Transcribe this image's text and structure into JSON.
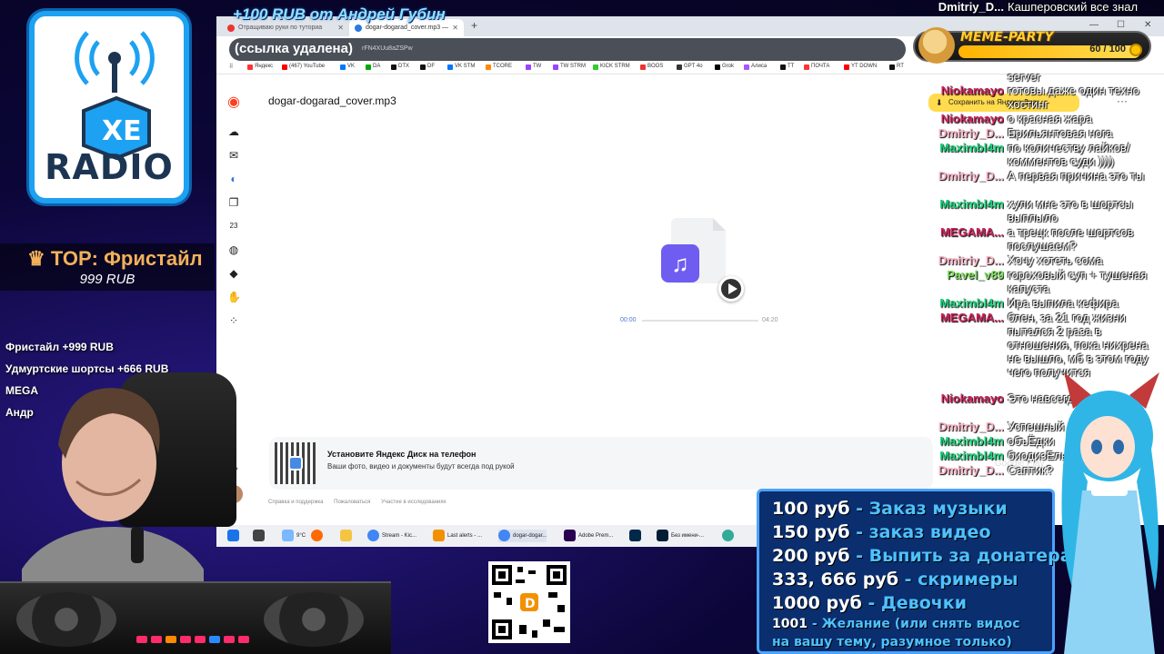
{
  "logo": {
    "text": "RADIO"
  },
  "top_donor": {
    "label": "TOP: Фристайл",
    "amount": "999 RUB"
  },
  "donors": [
    "Фристайл +999 RUB",
    "Удмуртские шортсы +666 RUB",
    "MEGA",
    "Андр"
  ],
  "banner": {
    "text": "+100 RUB  от Андрей Губин"
  },
  "browser": {
    "tabs": [
      {
        "label": "Отращиваю руки по туториа",
        "active": false
      },
      {
        "label": "dogar-dogarad_cover.mp3 —",
        "active": true
      }
    ],
    "new_tab": "+",
    "url_removed": "(ссылка удалена)",
    "url_tail": "rFN4XUu8aZSPw",
    "bookmarks": [
      "Яндекс",
      "(467) YouTube",
      "VK",
      "DA",
      "DTX",
      "DF",
      "VK STM",
      "TCORE",
      "TW",
      "TW STRM",
      "KICK STRM",
      "BOOS",
      "GPT 4o",
      "Grok",
      "Алиса",
      "TT",
      "ПОЧТА",
      "YT DOWN",
      "RT"
    ],
    "file_title": "dogar-dogarad_cover.mp3",
    "save_button": "Сохранить на Яндекс Диск",
    "more": "···",
    "player": {
      "current": "00:00",
      "total": "04:20",
      "progress": 0
    },
    "promo": {
      "title": "Установите Яндекс Диск на телефон",
      "subtitle": "Ваши фото, видео и документы будут всегда под рукой"
    },
    "footer_links": [
      "Справка и поддержка",
      "Пожаловаться",
      "Участие в исследованиях"
    ],
    "google_play": "Google Play"
  },
  "taskbar": {
    "weather": "9°C",
    "items": [
      "Stream - Kic...",
      "Last alerts - ...",
      "dogar-dogar...",
      "Adobe Prem...",
      "",
      "Без имени-..."
    ]
  },
  "meme_party": {
    "title": "MEME-PARTY",
    "count": "60 / 100"
  },
  "chat": [
    {
      "nick": "Dmitriy_D...",
      "color": "#ffffff",
      "text": "Кашперовский все знал"
    },
    {
      "nick": "",
      "color": "#ffffff",
      "text": "server"
    },
    {
      "nick": "Niokamayo",
      "color": "#d0215a",
      "text": "готовы даже один техно хостинг"
    },
    {
      "nick": "Niokamayo",
      "color": "#d0215a",
      "text": "о красная жара"
    },
    {
      "nick": "Dmitriy_D...",
      "color": "#ffb3c7",
      "text": "Брильянтовая нога"
    },
    {
      "nick": "Maximbl4m",
      "color": "#19d37a",
      "text": "по количеству лайков/комментов суди ))))"
    },
    {
      "nick": "Dmitriy_D...",
      "color": "#ffb3c7",
      "text": "А первая причина это ты"
    },
    {
      "nick": "Maximbl4m",
      "color": "#19d37a",
      "text": "хули мне это в шортсы выплыло"
    },
    {
      "nick": "MEGAMA...",
      "color": "#d0215a",
      "text": "а трецк после шортсов послушаем?"
    },
    {
      "nick": "Dmitriy_D...",
      "color": "#ffb3c7",
      "text": "Хочу хотеть сома"
    },
    {
      "nick": "Pavel_v89",
      "color": "#7be05a",
      "text": "гороховый суп + тушеная капуста"
    },
    {
      "nick": "Maximbl4m",
      "color": "#19d37a",
      "text": "Ира выпила кефира"
    },
    {
      "nick": "MEGAMA...",
      "color": "#d0215a",
      "text": "блен, за 21 год жизни пытался 2 раза в отношения, пока нихрена не вышло, мб в этом году чего получится"
    },
    {
      "nick": "Niokamayo",
      "color": "#d0215a",
      "text": "Это навсегда ехать"
    },
    {
      "nick": "Dmitriy_D...",
      "color": "#ffb3c7",
      "text": "Успешный"
    },
    {
      "nick": "Maximbl4m",
      "color": "#19d37a",
      "text": "объЁдки"
    },
    {
      "nick": "Maximbl4m",
      "color": "#19d37a",
      "text": "биодизЕль"
    },
    {
      "nick": "Dmitriy_D...",
      "color": "#ffb3c7",
      "text": "Саптик?"
    }
  ],
  "prices": [
    {
      "amount": "100 руб",
      "desc": " - Заказ музыки"
    },
    {
      "amount": "150 руб",
      "desc": " - заказ видео"
    },
    {
      "amount": "200 руб",
      "desc": " - Выпить за донатера"
    },
    {
      "amount": "333, 666 руб",
      "desc": " - скримеры"
    },
    {
      "amount": "1000 руб",
      "desc": " - Девочки"
    },
    {
      "amount": "1001",
      "desc": " - Желание (или снять видос"
    },
    {
      "amount": "",
      "desc": "на вашу тему, разумное только)"
    }
  ]
}
